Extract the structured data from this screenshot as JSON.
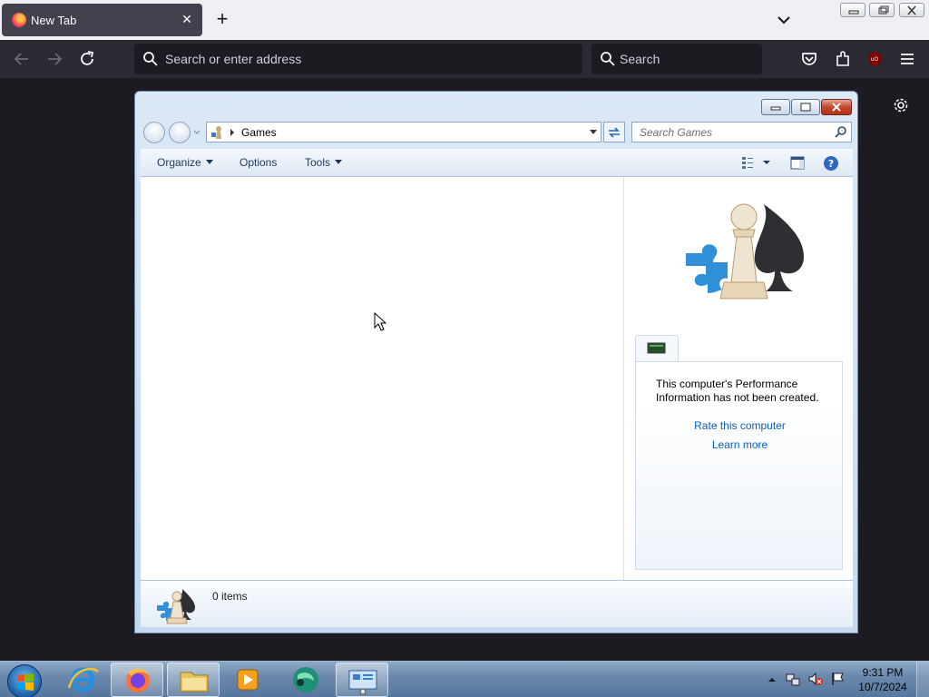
{
  "browser": {
    "tab_title": "New Tab",
    "tab_close": "✕",
    "new_tab": "+",
    "address_placeholder": "Search or enter address",
    "search_placeholder": "Search"
  },
  "explorer": {
    "address_location": "Games",
    "search_placeholder": "Search Games",
    "toolbar": {
      "organize": "Organize",
      "options": "Options",
      "tools": "Tools"
    },
    "performance": {
      "message": "This computer's Performance Information has not been created.",
      "rate_link": "Rate this computer",
      "learn_link": "Learn more"
    },
    "status_count": "0 items"
  },
  "taskbar": {
    "time": "9:31 PM",
    "date": "10/7/2024"
  },
  "colors": {
    "firefox_toolbar": "#2b2a33",
    "firefox_tab": "#42414d",
    "explorer_frame": "#c4d9ef",
    "link": "#0a5fc4",
    "taskbar": "#6c89ad"
  },
  "icons": [
    "firefox-icon",
    "plus-icon",
    "chevron-down-icon",
    "back-arrow-icon",
    "forward-arrow-icon",
    "reload-icon",
    "search-icon",
    "pocket-icon",
    "extensions-icon",
    "ublock-icon",
    "menu-icon",
    "gear-icon",
    "games-icon",
    "chess-games-icon",
    "computer-icon",
    "help-icon",
    "views-icon",
    "preview-pane-icon",
    "windows-start-icon",
    "internet-explorer-icon",
    "file-explorer-icon",
    "media-player-icon",
    "browser-app-icon",
    "control-panel-icon",
    "network-icon",
    "volume-muted-icon",
    "action-center-flag-icon"
  ]
}
